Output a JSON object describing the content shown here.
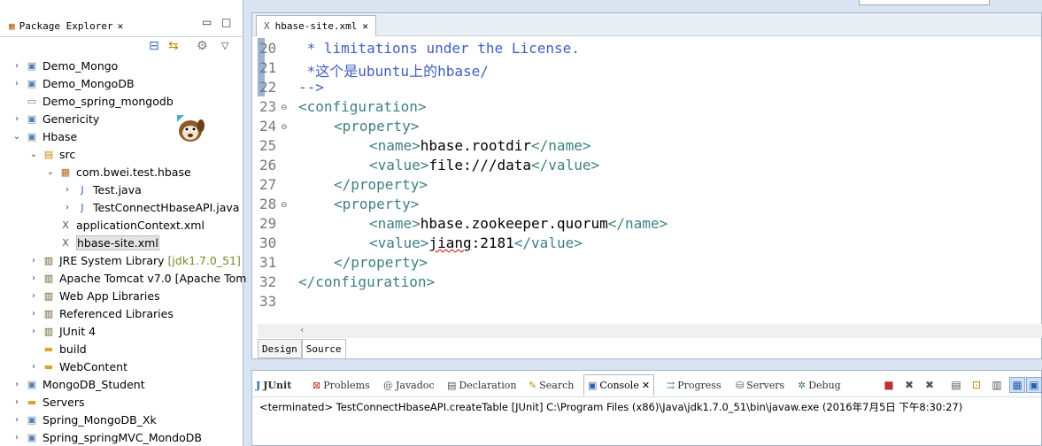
{
  "package_explorer": {
    "title": "Package Explorer",
    "tree": [
      {
        "label": "Demo_Mongo",
        "decoration": ""
      },
      {
        "label": "Demo_MongoDB",
        "decoration": ""
      },
      {
        "label": "Demo_spring_mongodb",
        "decoration": ""
      },
      {
        "label": "Genericity",
        "decoration": ""
      },
      {
        "label": "Hbase",
        "decoration": ""
      },
      {
        "label": "src",
        "decoration": ""
      },
      {
        "label": "com.bwei.test.hbase",
        "decoration": ""
      },
      {
        "label": "Test.java",
        "decoration": ""
      },
      {
        "label": "TestConnectHbaseAPI.java",
        "decoration": ""
      },
      {
        "label": "applicationContext.xml",
        "decoration": ""
      },
      {
        "label": "hbase-site.xml",
        "decoration": ""
      },
      {
        "label": "JRE System Library",
        "decoration": "[jdk1.7.0_51]"
      },
      {
        "label": "Apache Tomcat v7.0 [Apache Tom",
        "decoration": ""
      },
      {
        "label": "Web App Libraries",
        "decoration": ""
      },
      {
        "label": "Referenced Libraries",
        "decoration": ""
      },
      {
        "label": "JUnit 4",
        "decoration": ""
      },
      {
        "label": "build",
        "decoration": ""
      },
      {
        "label": "WebContent",
        "decoration": ""
      },
      {
        "label": "MongoDB_Student",
        "decoration": ""
      },
      {
        "label": "Servers",
        "decoration": ""
      },
      {
        "label": "Spring_MongoDB_Xk",
        "decoration": ""
      },
      {
        "label": "Spring_springMVC_MondoDB",
        "decoration": ""
      }
    ]
  },
  "editor": {
    "tab_title": "hbase-site.xml",
    "line_numbers": [
      "20",
      "21",
      "22",
      "23",
      "24",
      "25",
      "26",
      "27",
      "28",
      "29",
      "30",
      "31",
      "32",
      "33"
    ],
    "lines": {
      "l20": " * limitations under the License.",
      "l21": " *这个是ubuntu上的hbase/",
      "l22": "-->",
      "l23_tag": "<configuration>",
      "l24_tag": "<property>",
      "l25_open": "<name>",
      "l25_text": "hbase.rootdir",
      "l25_close": "</name>",
      "l26_open": "<value>",
      "l26_text": "file:///data",
      "l26_close": "</value>",
      "l27_tag": "</property>",
      "l28_tag": "<property>",
      "l29_open": "<name>",
      "l29_text": "hbase.zookeeper.quorum",
      "l29_close": "</name>",
      "l30_open": "<value>",
      "l30_text_a": "jiang",
      "l30_text_b": ":2181",
      "l30_close": "</value>",
      "l31_tag": "</property>",
      "l32_tag": "</configuration>"
    },
    "bottom_tabs": {
      "design": "Design",
      "source": "Source"
    }
  },
  "console": {
    "tabs": {
      "junit": "JUnit",
      "problems": "Problems",
      "javadoc": "Javadoc",
      "declaration": "Declaration",
      "search": "Search",
      "console": "Console",
      "progress": "Progress",
      "servers": "Servers",
      "debug": "Debug"
    },
    "output": "<terminated> TestConnectHbaseAPI.createTable [JUnit] C:\\Program Files (x86)\\Java\\jdk1.7.0_51\\bin\\javaw.exe (2016年7月5日 下午8:30:27)"
  },
  "colors": {
    "comment": "#3f5fbf",
    "tag": "#3f7f7f",
    "accent": "#a9b7c9"
  }
}
